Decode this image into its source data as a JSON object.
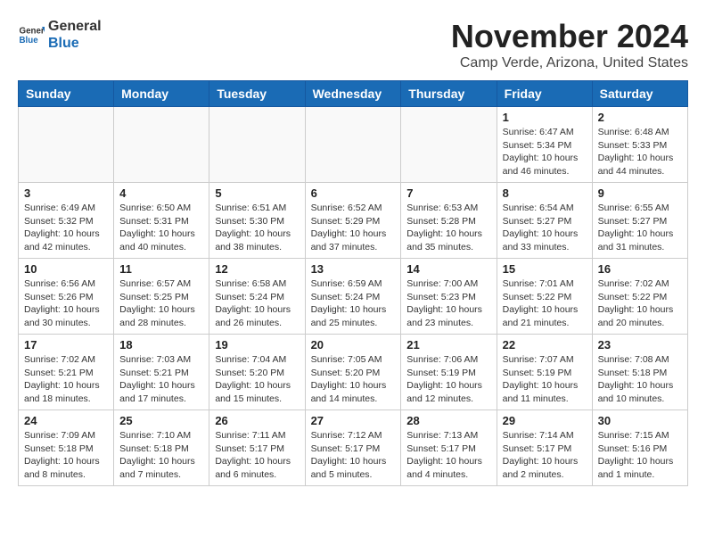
{
  "header": {
    "logo_line1": "General",
    "logo_line2": "Blue",
    "month_title": "November 2024",
    "location": "Camp Verde, Arizona, United States"
  },
  "weekdays": [
    "Sunday",
    "Monday",
    "Tuesday",
    "Wednesday",
    "Thursday",
    "Friday",
    "Saturday"
  ],
  "weeks": [
    [
      {
        "day": "",
        "info": ""
      },
      {
        "day": "",
        "info": ""
      },
      {
        "day": "",
        "info": ""
      },
      {
        "day": "",
        "info": ""
      },
      {
        "day": "",
        "info": ""
      },
      {
        "day": "1",
        "info": "Sunrise: 6:47 AM\nSunset: 5:34 PM\nDaylight: 10 hours and 46 minutes."
      },
      {
        "day": "2",
        "info": "Sunrise: 6:48 AM\nSunset: 5:33 PM\nDaylight: 10 hours and 44 minutes."
      }
    ],
    [
      {
        "day": "3",
        "info": "Sunrise: 6:49 AM\nSunset: 5:32 PM\nDaylight: 10 hours and 42 minutes."
      },
      {
        "day": "4",
        "info": "Sunrise: 6:50 AM\nSunset: 5:31 PM\nDaylight: 10 hours and 40 minutes."
      },
      {
        "day": "5",
        "info": "Sunrise: 6:51 AM\nSunset: 5:30 PM\nDaylight: 10 hours and 38 minutes."
      },
      {
        "day": "6",
        "info": "Sunrise: 6:52 AM\nSunset: 5:29 PM\nDaylight: 10 hours and 37 minutes."
      },
      {
        "day": "7",
        "info": "Sunrise: 6:53 AM\nSunset: 5:28 PM\nDaylight: 10 hours and 35 minutes."
      },
      {
        "day": "8",
        "info": "Sunrise: 6:54 AM\nSunset: 5:27 PM\nDaylight: 10 hours and 33 minutes."
      },
      {
        "day": "9",
        "info": "Sunrise: 6:55 AM\nSunset: 5:27 PM\nDaylight: 10 hours and 31 minutes."
      }
    ],
    [
      {
        "day": "10",
        "info": "Sunrise: 6:56 AM\nSunset: 5:26 PM\nDaylight: 10 hours and 30 minutes."
      },
      {
        "day": "11",
        "info": "Sunrise: 6:57 AM\nSunset: 5:25 PM\nDaylight: 10 hours and 28 minutes."
      },
      {
        "day": "12",
        "info": "Sunrise: 6:58 AM\nSunset: 5:24 PM\nDaylight: 10 hours and 26 minutes."
      },
      {
        "day": "13",
        "info": "Sunrise: 6:59 AM\nSunset: 5:24 PM\nDaylight: 10 hours and 25 minutes."
      },
      {
        "day": "14",
        "info": "Sunrise: 7:00 AM\nSunset: 5:23 PM\nDaylight: 10 hours and 23 minutes."
      },
      {
        "day": "15",
        "info": "Sunrise: 7:01 AM\nSunset: 5:22 PM\nDaylight: 10 hours and 21 minutes."
      },
      {
        "day": "16",
        "info": "Sunrise: 7:02 AM\nSunset: 5:22 PM\nDaylight: 10 hours and 20 minutes."
      }
    ],
    [
      {
        "day": "17",
        "info": "Sunrise: 7:02 AM\nSunset: 5:21 PM\nDaylight: 10 hours and 18 minutes."
      },
      {
        "day": "18",
        "info": "Sunrise: 7:03 AM\nSunset: 5:21 PM\nDaylight: 10 hours and 17 minutes."
      },
      {
        "day": "19",
        "info": "Sunrise: 7:04 AM\nSunset: 5:20 PM\nDaylight: 10 hours and 15 minutes."
      },
      {
        "day": "20",
        "info": "Sunrise: 7:05 AM\nSunset: 5:20 PM\nDaylight: 10 hours and 14 minutes."
      },
      {
        "day": "21",
        "info": "Sunrise: 7:06 AM\nSunset: 5:19 PM\nDaylight: 10 hours and 12 minutes."
      },
      {
        "day": "22",
        "info": "Sunrise: 7:07 AM\nSunset: 5:19 PM\nDaylight: 10 hours and 11 minutes."
      },
      {
        "day": "23",
        "info": "Sunrise: 7:08 AM\nSunset: 5:18 PM\nDaylight: 10 hours and 10 minutes."
      }
    ],
    [
      {
        "day": "24",
        "info": "Sunrise: 7:09 AM\nSunset: 5:18 PM\nDaylight: 10 hours and 8 minutes."
      },
      {
        "day": "25",
        "info": "Sunrise: 7:10 AM\nSunset: 5:18 PM\nDaylight: 10 hours and 7 minutes."
      },
      {
        "day": "26",
        "info": "Sunrise: 7:11 AM\nSunset: 5:17 PM\nDaylight: 10 hours and 6 minutes."
      },
      {
        "day": "27",
        "info": "Sunrise: 7:12 AM\nSunset: 5:17 PM\nDaylight: 10 hours and 5 minutes."
      },
      {
        "day": "28",
        "info": "Sunrise: 7:13 AM\nSunset: 5:17 PM\nDaylight: 10 hours and 4 minutes."
      },
      {
        "day": "29",
        "info": "Sunrise: 7:14 AM\nSunset: 5:17 PM\nDaylight: 10 hours and 2 minutes."
      },
      {
        "day": "30",
        "info": "Sunrise: 7:15 AM\nSunset: 5:16 PM\nDaylight: 10 hours and 1 minute."
      }
    ]
  ]
}
